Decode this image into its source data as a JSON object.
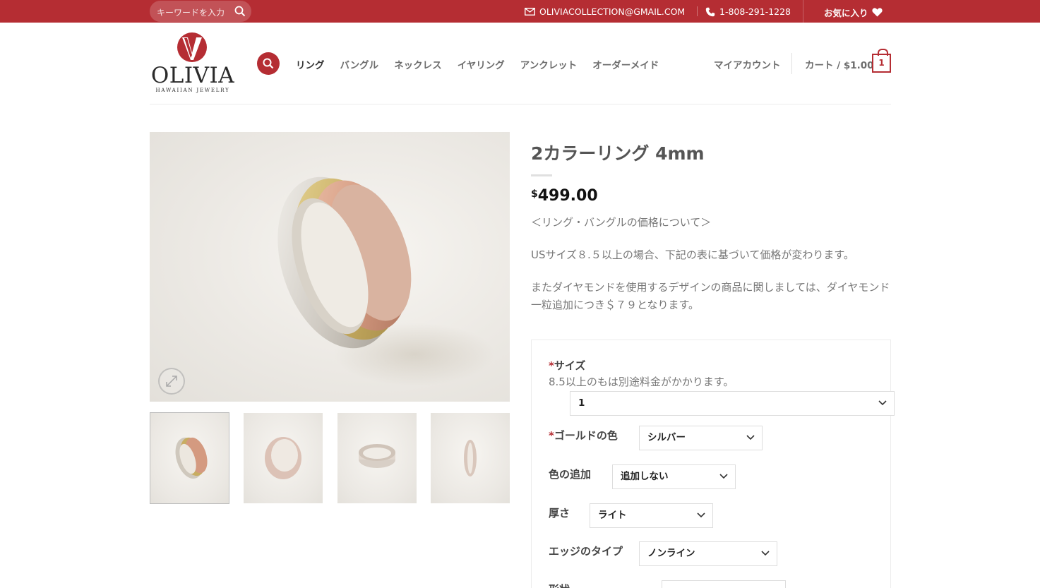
{
  "topbar": {
    "search_placeholder": "キーワードを入力",
    "email": "OLIVIACOLLECTION@GMAIL.COM",
    "phone": "1-808-291-1228",
    "favorites": "お気に入り"
  },
  "header": {
    "logo_text": "OLIVIA",
    "logo_subtext": "HAWAIIAN JEWELRY",
    "nav": [
      "リング",
      "バングル",
      "ネックレス",
      "イヤリング",
      "アンクレット",
      "オーダーメイド"
    ],
    "account": "マイアカウント",
    "cart_label": "カート / $1.00",
    "cart_count": "1"
  },
  "product": {
    "title": "2カラーリング 4mm",
    "price_currency": "$",
    "price_amount": "499.00",
    "desc_1": "＜リング・バングルの価格について＞",
    "desc_2": "USサイズ８.５以上の場合、下記の表に基づいて価格が変わります。",
    "desc_3": "またダイヤモンドを使用するデザインの商品に関しましては、ダイヤモンド一粒追加につき＄７９となります。"
  },
  "options": {
    "required_mark": "*",
    "size_label": "サイズ",
    "size_note": "8.5以上のもは別途料金がかかります。",
    "size_value": "1",
    "gold_label": "ゴールドの色",
    "gold_value": "シルバー",
    "color_add_label": "色の追加",
    "color_add_value": "追加しない",
    "thickness_label": "厚さ",
    "thickness_value": "ライト",
    "edge_label": "エッジのタイプ",
    "edge_value": "ノンライン",
    "shape_label": "形状"
  },
  "colors": {
    "brand_red": "#b52d33"
  }
}
